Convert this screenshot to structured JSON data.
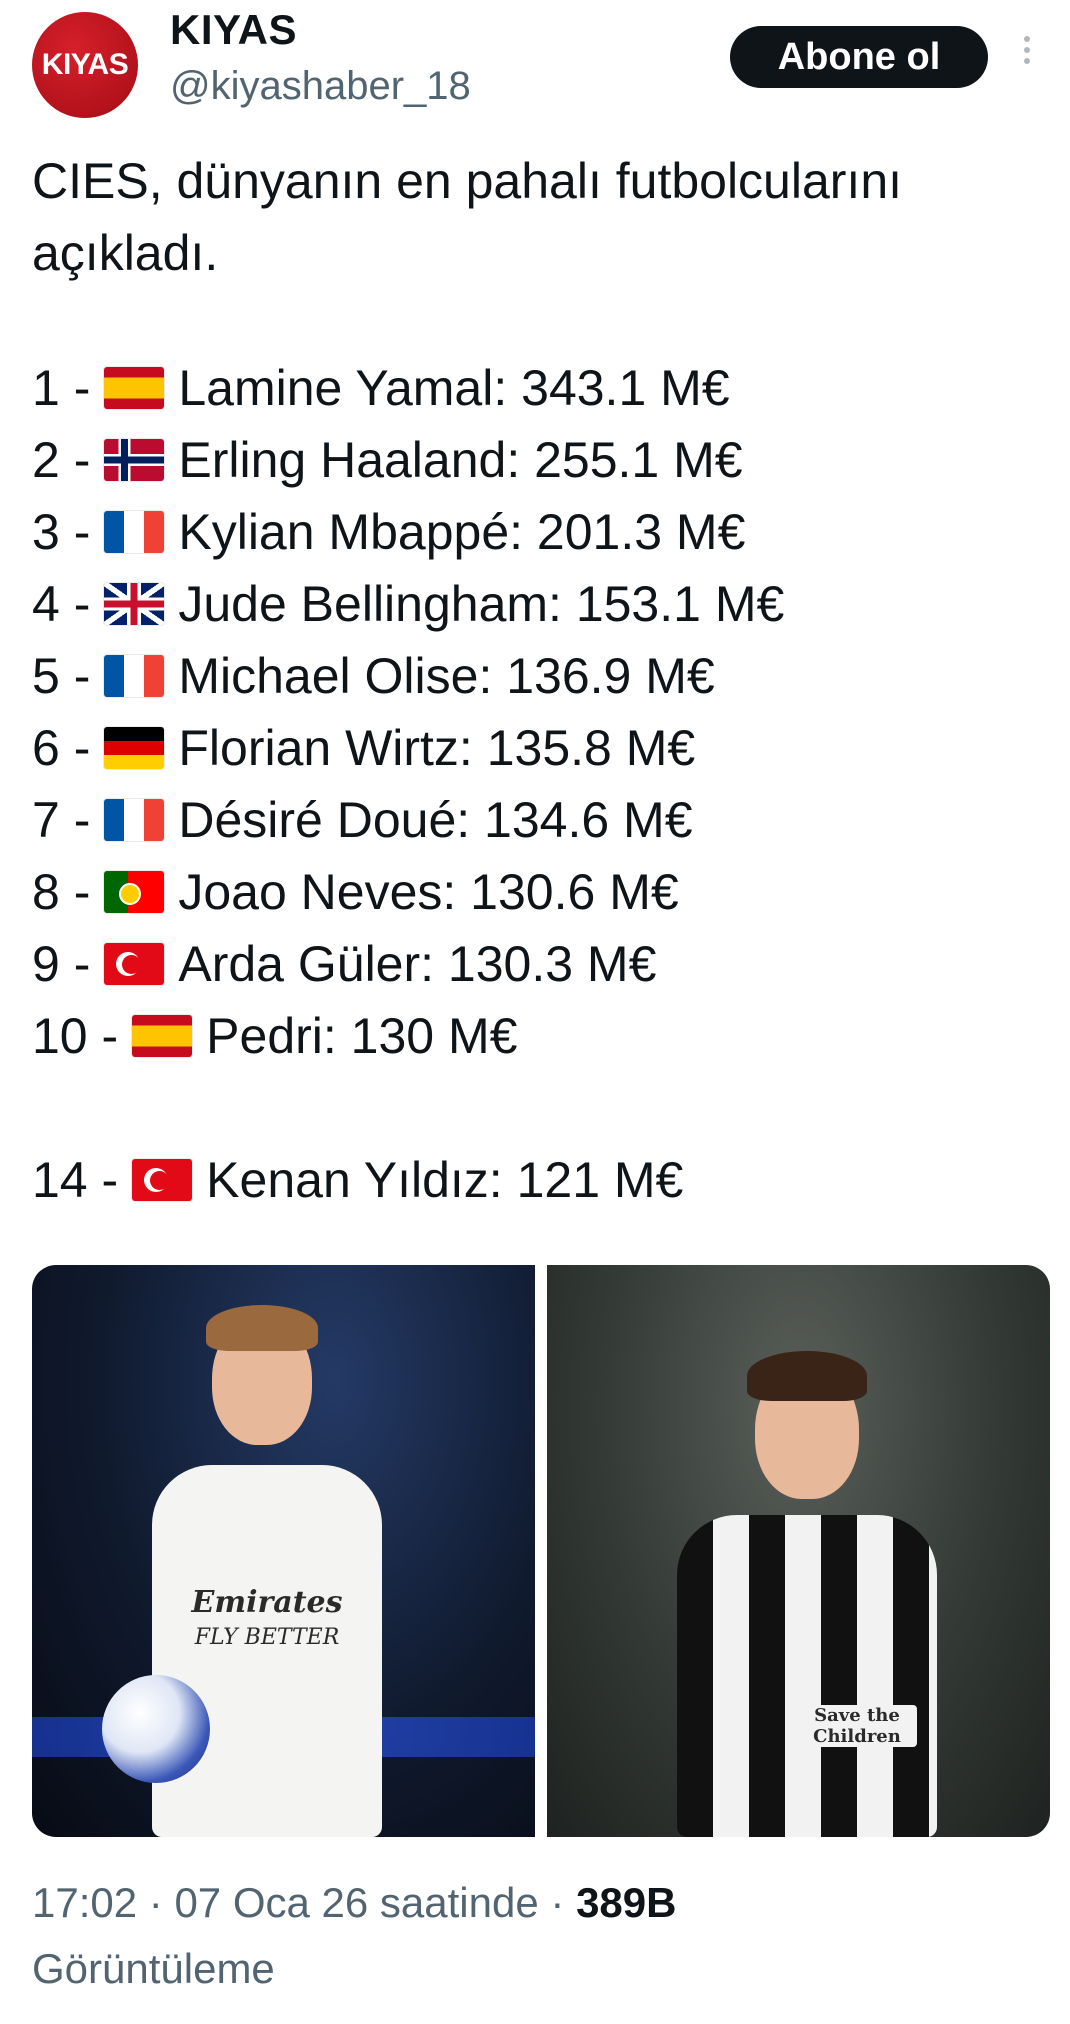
{
  "author": {
    "avatar_text": "KIYAS",
    "name": "KIYAS",
    "handle": "@kiyashaber_18",
    "follow_label": "Abone ol"
  },
  "tweet": {
    "intro_line1": "CIES, dünyanın en pahalı futbolcularını",
    "intro_line2": "açıkladı.",
    "players": [
      {
        "rank": "1 -",
        "flag": "spain-flag",
        "text": "Lamine Yamal: 343.1 M€"
      },
      {
        "rank": "2 -",
        "flag": "norway-flag",
        "text": "Erling Haaland: 255.1 M€"
      },
      {
        "rank": "3 -",
        "flag": "france-flag",
        "text": "Kylian Mbappé: 201.3 M€"
      },
      {
        "rank": "4 -",
        "flag": "uk-flag",
        "text": "Jude Bellingham: 153.1 M€"
      },
      {
        "rank": "5 -",
        "flag": "france-flag",
        "text": "Michael Olise: 136.9 M€"
      },
      {
        "rank": "6 -",
        "flag": "germany-flag",
        "text": "Florian Wirtz: 135.8 M€"
      },
      {
        "rank": "7 -",
        "flag": "france-flag",
        "text": "Désiré Doué: 134.6 M€"
      },
      {
        "rank": "8 -",
        "flag": "portugal-flag",
        "text": "Joao Neves: 130.6 M€"
      },
      {
        "rank": "9 -",
        "flag": "turkey-flag",
        "text": "Arda Güler: 130.3 M€"
      },
      {
        "rank": "10 -",
        "flag": "spain-flag",
        "text": "Pedri: 130 M€"
      },
      {
        "rank": "14 -",
        "flag": "turkey-flag",
        "text": "Kenan Yıldız: 121 M€"
      }
    ]
  },
  "media": {
    "left_shirt_sponsor": "Emirates",
    "left_shirt_sub": "FLY BETTER",
    "right_shirt_sponsor": "Save the Children"
  },
  "meta": {
    "time": "17:02",
    "sep1": "·",
    "date": "07 Oca 26 saatinde",
    "sep2": "·",
    "views": "389B",
    "views_label": "Görüntüleme"
  },
  "colors": {
    "text": "#0f1419",
    "muted": "#536471",
    "button": "#0f1419",
    "avatar": "#c4121e"
  }
}
